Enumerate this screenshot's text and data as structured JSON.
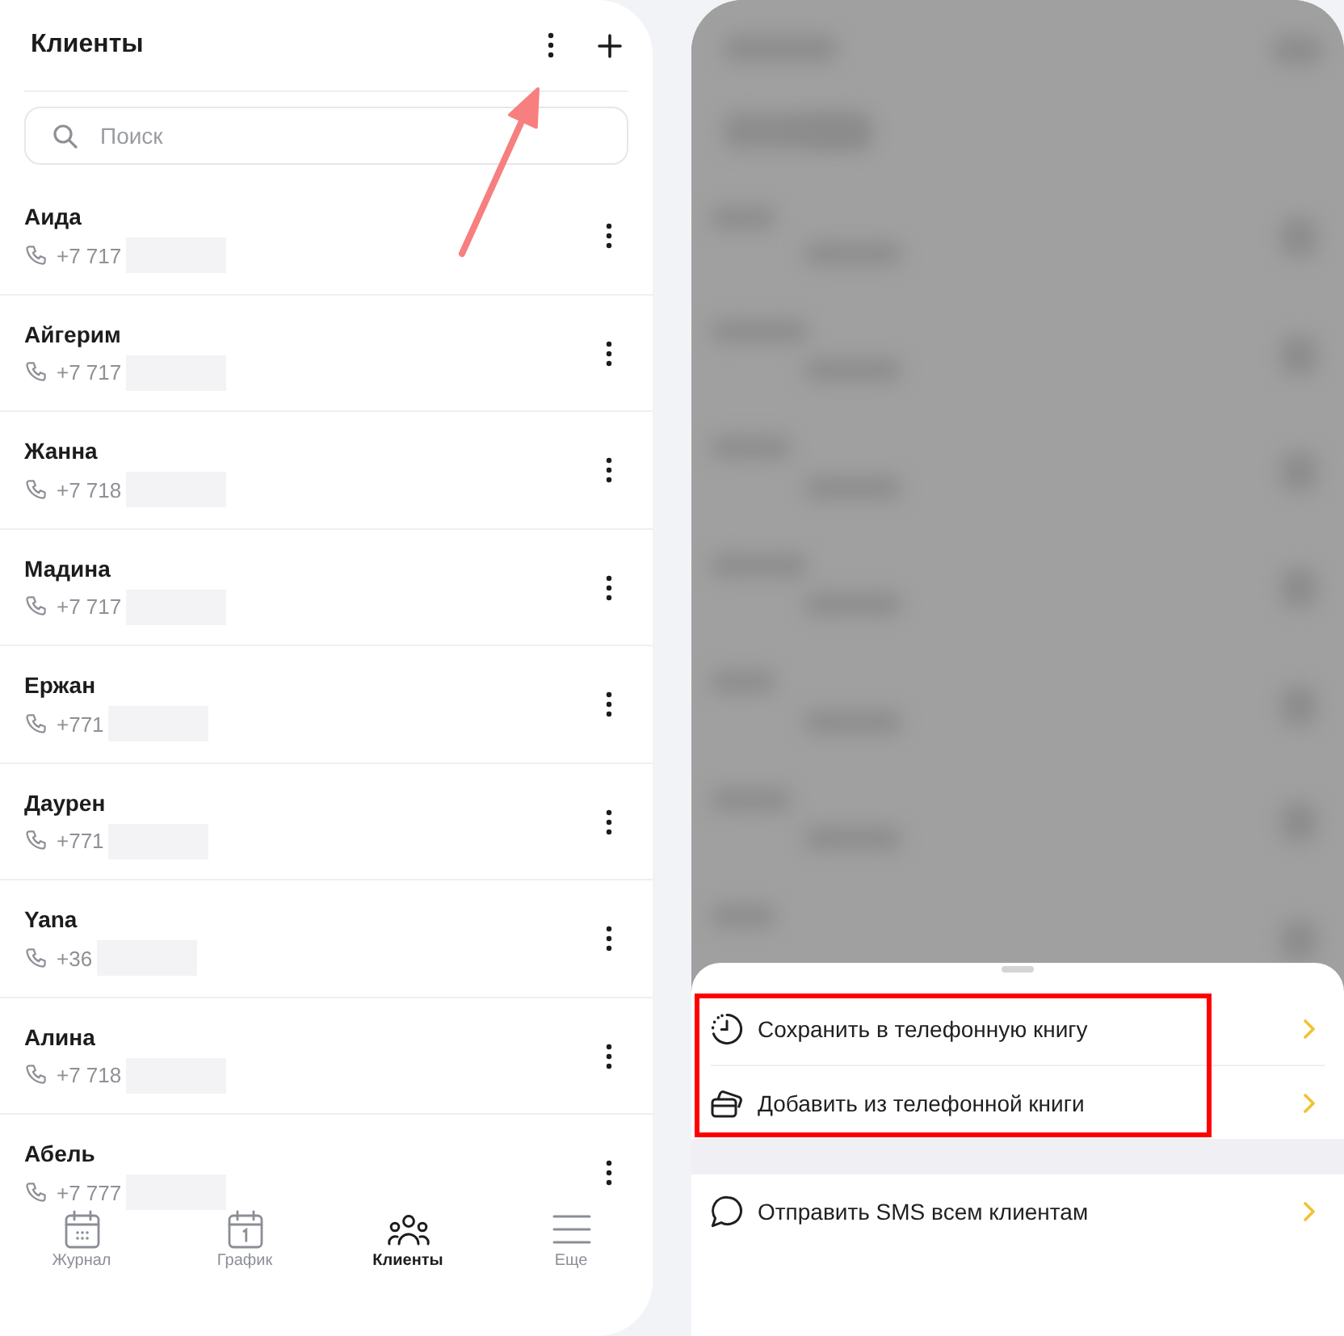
{
  "left_screen": {
    "header": {
      "title": "Клиенты",
      "menu_arrow": true
    },
    "search": {
      "placeholder": "Поиск"
    },
    "clients": [
      {
        "name": "Аида",
        "phone": "+7 717"
      },
      {
        "name": "Айгерим",
        "phone": "+7 717"
      },
      {
        "name": "Жанна",
        "phone": "+7 718"
      },
      {
        "name": "Мадина",
        "phone": "+7 717"
      },
      {
        "name": "Ержан",
        "phone": "+771"
      },
      {
        "name": "Даурен",
        "phone": "+771"
      },
      {
        "name": "Yana",
        "phone": "+36"
      },
      {
        "name": "Алина",
        "phone": "+7 718"
      },
      {
        "name": "Абель",
        "phone": "+7 777"
      }
    ],
    "bottom_nav": [
      {
        "kind": "journal",
        "label": "Журнал",
        "selected": false
      },
      {
        "kind": "schedule",
        "label": "График",
        "selected": false
      },
      {
        "kind": "clients",
        "label": "Клиенты",
        "selected": true
      },
      {
        "kind": "more",
        "label": "Еще",
        "selected": false
      }
    ]
  },
  "right_screen": {
    "action_sheet": {
      "groups": [
        {
          "highlighted": true,
          "items": [
            {
              "kind": "save",
              "label": "Сохранить в телефонную книгу"
            },
            {
              "kind": "import",
              "label": "Добавить из телефонной книги"
            }
          ]
        },
        {
          "highlighted": false,
          "items": [
            {
              "kind": "sms",
              "label": "Отправить SMS всем клиентам"
            }
          ]
        }
      ]
    }
  }
}
